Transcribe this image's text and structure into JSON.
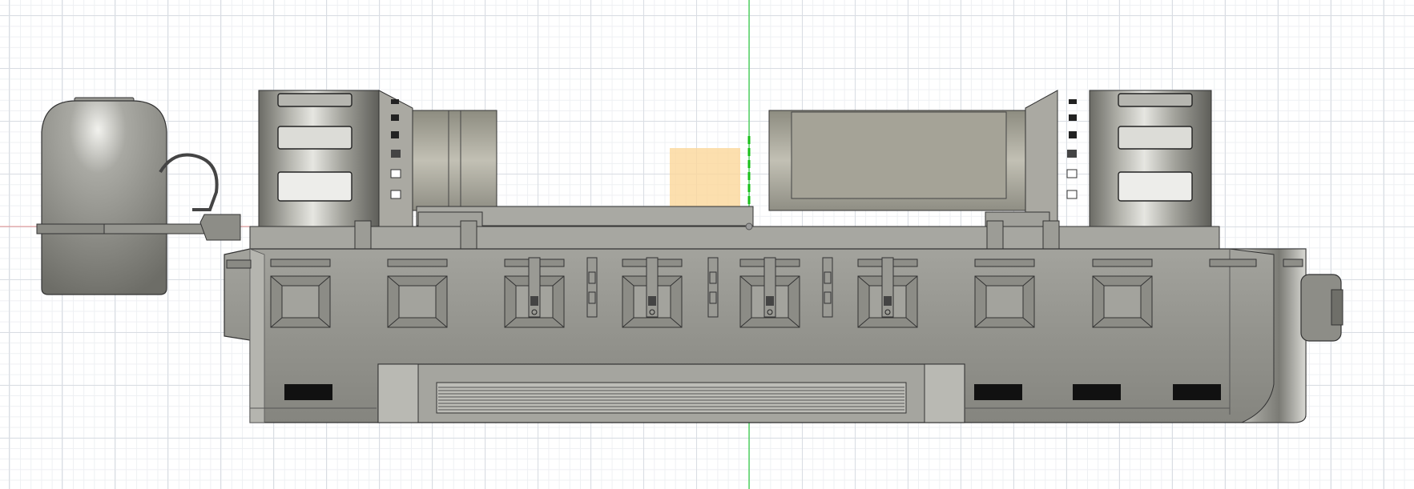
{
  "viewport": {
    "background": "#ffffff",
    "grid_major": "#d9dde3",
    "grid_minor": "#eef0f3"
  },
  "axes": {
    "vertical_axis_color": "#2ecc40",
    "horizontal_axis_color": "#e06666"
  },
  "model": {
    "body_color": "#9a9a92",
    "body_dark": "#6e6e68",
    "body_light": "#cfcfc9",
    "edge_color": "#2b2b2b",
    "vent_color": "#111111"
  },
  "selection": {
    "highlight_color": "#fbd79a"
  }
}
